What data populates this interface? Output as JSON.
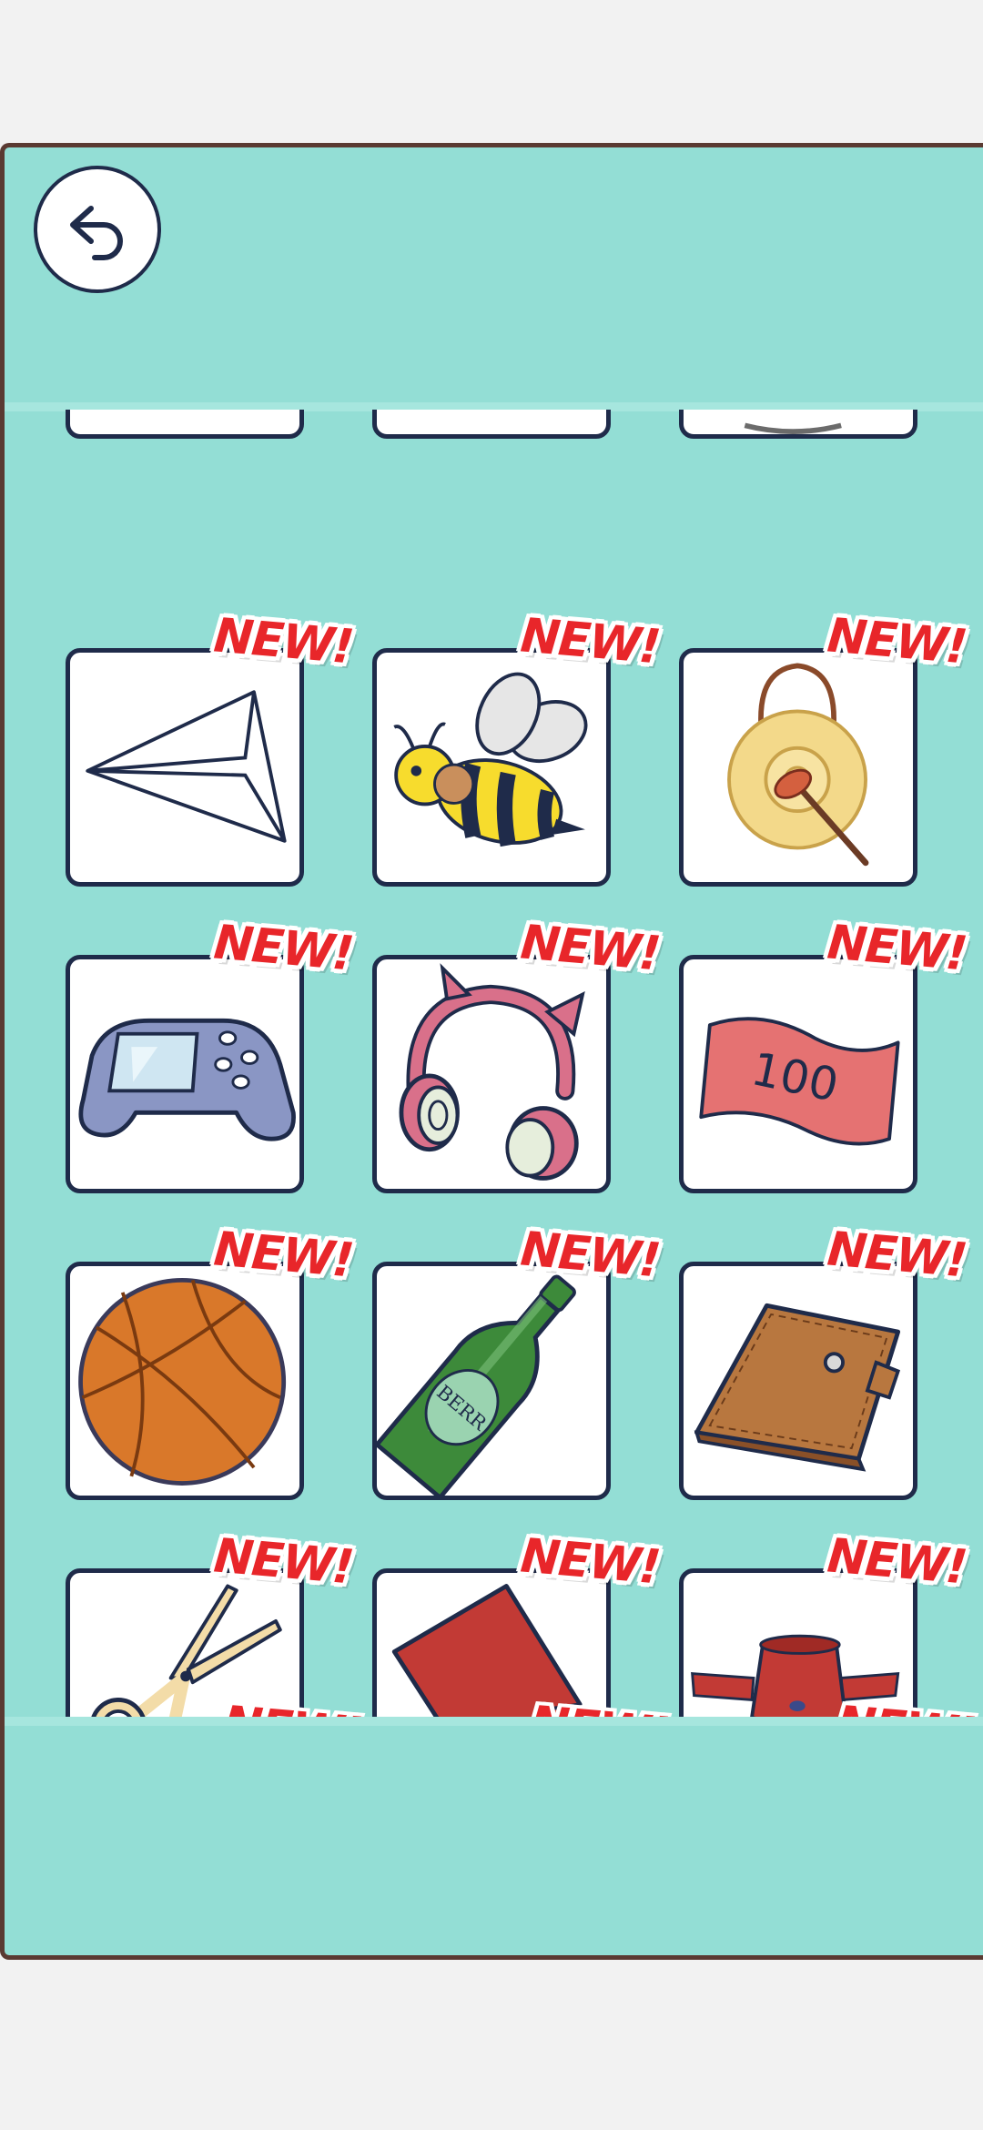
{
  "header": {
    "back_button": "back-arrow-icon"
  },
  "badge_text": "NEW!",
  "items": [
    {
      "name": "paper-plane",
      "badge": "NEW!"
    },
    {
      "name": "bee",
      "badge": "NEW!"
    },
    {
      "name": "gong",
      "badge": "NEW!"
    },
    {
      "name": "game-controller",
      "badge": "NEW!"
    },
    {
      "name": "headphones",
      "badge": "NEW!"
    },
    {
      "name": "banknote",
      "badge": "NEW!",
      "label": "100"
    },
    {
      "name": "basketball",
      "badge": "NEW!"
    },
    {
      "name": "beer-bottle",
      "badge": "NEW!",
      "label": "BERR"
    },
    {
      "name": "wallet",
      "badge": "NEW!"
    },
    {
      "name": "scissors",
      "badge": "NEW!"
    },
    {
      "name": "red-paper",
      "badge": "NEW!"
    },
    {
      "name": "red-hat",
      "badge": "NEW!"
    }
  ],
  "colors": {
    "background": "#93ded5",
    "border": "#1f2b4a",
    "badge": "#e8262a"
  }
}
